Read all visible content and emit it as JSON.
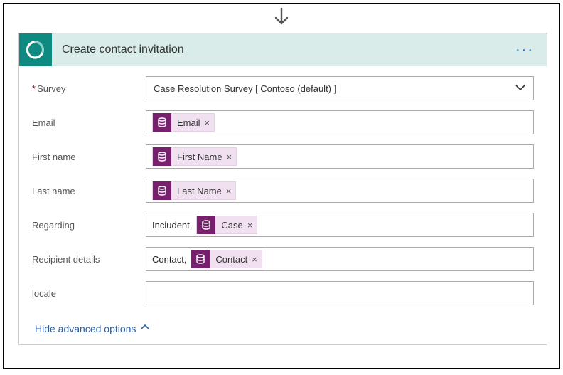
{
  "header": {
    "title": "Create contact invitation",
    "icon": "forms-pro-icon",
    "menu": "···"
  },
  "fields": {
    "survey": {
      "label": "Survey",
      "required": true,
      "value": "Case Resolution Survey  [ Contoso (default) ]"
    },
    "email": {
      "label": "Email",
      "token": "Email"
    },
    "first_name": {
      "label": "First name",
      "token": "First Name"
    },
    "last_name": {
      "label": "Last name",
      "token": "Last Name"
    },
    "regarding": {
      "label": "Regarding",
      "prefix": "Inciudent,",
      "token": "Case"
    },
    "recipient": {
      "label": "Recipient details",
      "prefix": "Contact,",
      "token": "Contact"
    },
    "locale": {
      "label": "locale",
      "value": ""
    }
  },
  "advanced": {
    "label": "Hide advanced options"
  }
}
